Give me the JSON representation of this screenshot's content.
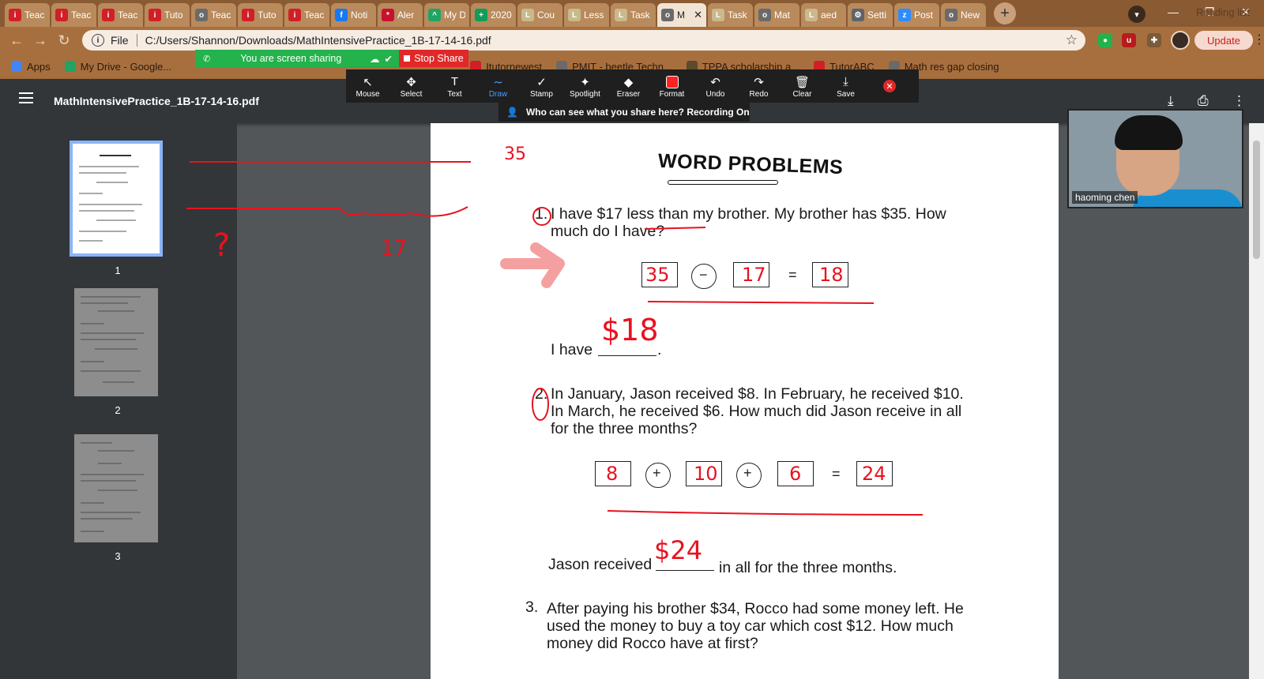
{
  "browser": {
    "tabs": [
      {
        "label": "Teac",
        "icon": "i",
        "color": "#d01f26"
      },
      {
        "label": "Teac",
        "icon": "i",
        "color": "#d01f26"
      },
      {
        "label": "Teac",
        "icon": "i",
        "color": "#d01f26"
      },
      {
        "label": "Tuto",
        "icon": "i",
        "color": "#d01f26"
      },
      {
        "label": "Teac",
        "icon": "o",
        "color": "#6a6a6a"
      },
      {
        "label": "Tuto",
        "icon": "i",
        "color": "#d01f26"
      },
      {
        "label": "Teac",
        "icon": "i",
        "color": "#d01f26"
      },
      {
        "label": "Noti",
        "icon": "f",
        "color": "#1877f2"
      },
      {
        "label": "Aler",
        "icon": "*",
        "color": "#c8102e"
      },
      {
        "label": "My D",
        "icon": "^",
        "color": "#1fa463"
      },
      {
        "label": "2020",
        "icon": "+",
        "color": "#0f9d58"
      },
      {
        "label": "Cou",
        "icon": "L",
        "color": "#c9b98c"
      },
      {
        "label": "Less",
        "icon": "L",
        "color": "#c9b98c"
      },
      {
        "label": "Task",
        "icon": "L",
        "color": "#c9b98c"
      },
      {
        "label": "M",
        "icon": "o",
        "color": "#6a6a6a",
        "active": true
      },
      {
        "label": "Task",
        "icon": "L",
        "color": "#c9b98c"
      },
      {
        "label": "Mat",
        "icon": "o",
        "color": "#6a6a6a"
      },
      {
        "label": "aed",
        "icon": "L",
        "color": "#c9b98c"
      },
      {
        "label": "Setti",
        "icon": "⚙",
        "color": "#5f6368"
      },
      {
        "label": "Post",
        "icon": "z",
        "color": "#2d8cff"
      },
      {
        "label": "New",
        "icon": "o",
        "color": "#6a6a6a"
      }
    ],
    "address": {
      "scheme_label": "File",
      "url": "C:/Users/Shannon/Downloads/MathIntensivePractice_1B-17-14-16.pdf"
    },
    "update_label": "Update",
    "bookmarks": [
      {
        "label": "Apps",
        "color": "#4285f4"
      },
      {
        "label": "My Drive - Google...",
        "color": "#1fa463"
      },
      {
        "label": "Itutornewest",
        "color": "#d01f26"
      },
      {
        "label": "PMIT - beetle Techn...",
        "color": "#6a6a6a"
      },
      {
        "label": "TPPA scholarship a...",
        "color": "#5b4a2e"
      },
      {
        "label": "TutorABC",
        "color": "#d01f26"
      },
      {
        "label": "Math res gap closing",
        "color": "#6a6a6a"
      }
    ],
    "reading_list": "Reading list"
  },
  "zoom": {
    "sharing_banner": "You are screen sharing",
    "stop_share": "Stop Share",
    "tools": [
      {
        "label": "Mouse",
        "icon": "↖"
      },
      {
        "label": "Select",
        "icon": "✥"
      },
      {
        "label": "Text",
        "icon": "T"
      },
      {
        "label": "Draw",
        "icon": "∼",
        "active": true
      },
      {
        "label": "Stamp",
        "icon": "✓"
      },
      {
        "label": "Spotlight",
        "icon": "✦"
      },
      {
        "label": "Eraser",
        "icon": "◆"
      },
      {
        "label": "Format",
        "icon": "■"
      },
      {
        "label": "Undo",
        "icon": "↶"
      },
      {
        "label": "Redo",
        "icon": "↷"
      },
      {
        "label": "Clear",
        "icon": "🗑"
      },
      {
        "label": "Save",
        "icon": "⤓"
      }
    ],
    "who_can_see": "Who can see what you share here? Recording On",
    "participant_name": "haoming   chen"
  },
  "pdf": {
    "filename": "MathIntensivePractice_1B-17-14-16.pdf",
    "thumbnails": [
      {
        "number": "1"
      },
      {
        "number": "2"
      },
      {
        "number": "3"
      }
    ],
    "page": {
      "title": "WORD PROBLEMS",
      "q1_num": "1.",
      "q1_line1": "I have $17 less than my brother. My brother has $35. How",
      "q1_line2": "much do I have?",
      "q1_op": "−",
      "q1_eq": "=",
      "q1_answer_prefix": "I have",
      "q1_answer_suffix": ".",
      "q2_num": "2.",
      "q2_line1": "In January, Jason received $8. In February, he received $10.",
      "q2_line2": "In March, he received $6. How much did Jason receive in all",
      "q2_line3": "for the three months?",
      "q2_op1": "+",
      "q2_op2": "+",
      "q2_eq": "=",
      "q2_answer_prefix": "Jason received",
      "q2_answer_suffix": "in all for the three months.",
      "q3_num": "3.",
      "q3_line1": "After paying his brother $34, Rocco had some money left. He",
      "q3_line2": "used the money to buy a toy car which cost $12. How much",
      "q3_line3": "money did Rocco have at first?"
    },
    "handwriting": {
      "margin_35": "35",
      "margin_17": "17",
      "margin_question": "?",
      "q1_boxes": [
        "35",
        "17",
        "18"
      ],
      "q1_answer": "$18",
      "q2_boxes": [
        "8",
        "10",
        "6",
        "24"
      ],
      "q2_answer": "$24"
    }
  },
  "colors": {
    "annotation_red": "#e8121f",
    "arrow_pink": "#f4a0a0",
    "zoom_green": "#23b24b",
    "zoom_red": "#e02828",
    "pdf_dark": "#323639"
  }
}
